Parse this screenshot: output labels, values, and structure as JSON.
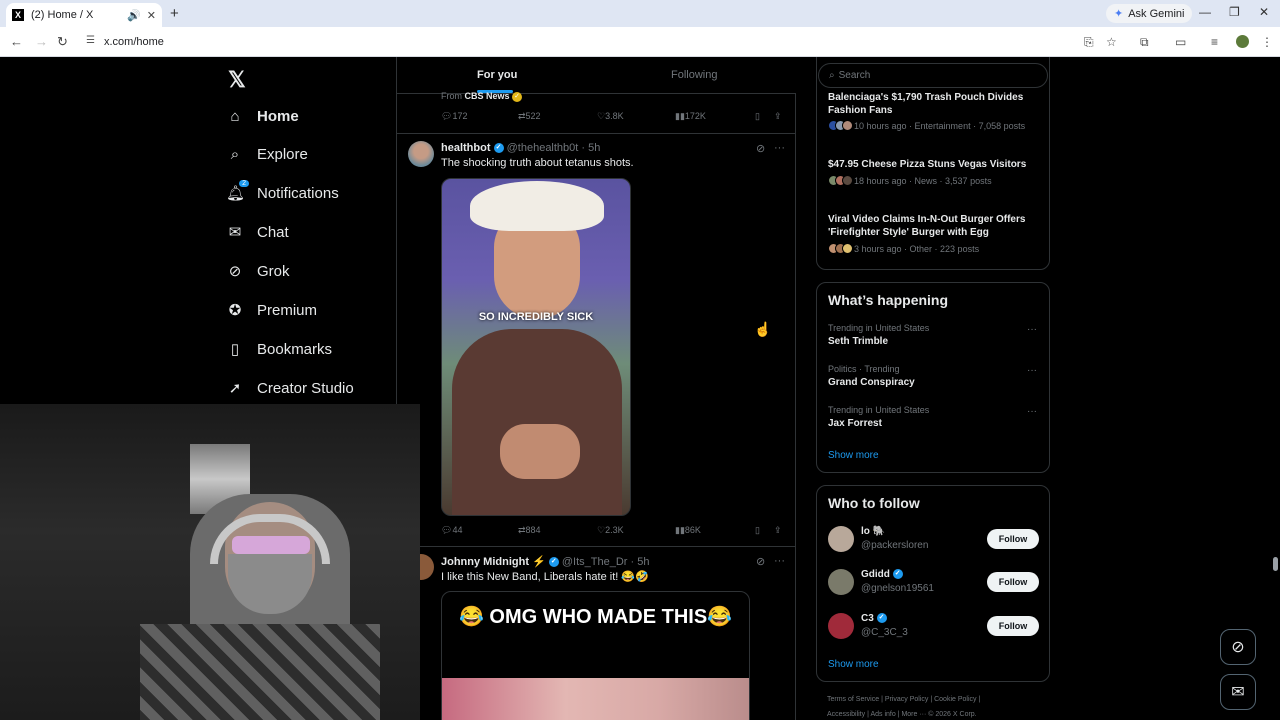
{
  "browser": {
    "tab_title": "(2) Home / X",
    "favicon": "X",
    "url": "x.com/home",
    "gemini_label": "Ask Gemini"
  },
  "nav": {
    "logo": "𝕏",
    "items": [
      {
        "label": "Home",
        "icon": "home-icon",
        "glyph": "⌂"
      },
      {
        "label": "Explore",
        "icon": "search-icon",
        "glyph": "⌕"
      },
      {
        "label": "Notifications",
        "icon": "bell-icon",
        "glyph": "♫",
        "badge": "2"
      },
      {
        "label": "Chat",
        "icon": "mail-icon",
        "glyph": "✉"
      },
      {
        "label": "Grok",
        "icon": "grok-icon",
        "glyph": "⊘"
      },
      {
        "label": "Premium",
        "icon": "verified-icon",
        "glyph": "✪"
      },
      {
        "label": "Bookmarks",
        "icon": "bookmark-icon",
        "glyph": "▯"
      },
      {
        "label": "Creator Studio",
        "icon": "rocket-icon",
        "glyph": "➚"
      }
    ]
  },
  "feed": {
    "tabs": {
      "for_you": "For you",
      "following": "Following"
    },
    "prev_post": {
      "source_prefix": "From",
      "source": "CBS News",
      "replies": "172",
      "reposts": "522",
      "likes": "3.8K",
      "views": "172K"
    },
    "post1": {
      "name": "healthbot",
      "handle": "@thehealthb0t · 5h",
      "text": "The shocking truth about tetanus shots.",
      "media_caption": "SO INCREDIBLY SICK",
      "replies": "44",
      "reposts": "884",
      "likes": "2.3K",
      "views": "86K"
    },
    "post2": {
      "name": "Johnny Midnight ⚡",
      "handle": "@Its_The_Dr · 5h",
      "text": "I like this New Band, Liberals hate it! 😂🤣",
      "media_caption": "😂 OMG WHO MADE THIS😂"
    }
  },
  "sidebar": {
    "search_placeholder": "Search",
    "news": [
      {
        "title": "Balenciaga's $1,790 Trash Pouch Divides Fashion Fans",
        "meta": "10 hours ago · Entertainment · 7,058 posts"
      },
      {
        "title": "$47.95 Cheese Pizza Stuns Vegas Visitors",
        "meta": "18 hours ago · News · 3,537 posts"
      },
      {
        "title": "Viral Video Claims In-N-Out Burger Offers 'Firefighter Style' Burger with Egg",
        "meta": "3 hours ago · Other · 223 posts"
      }
    ],
    "whats_happening": {
      "heading": "What’s happening",
      "trends": [
        {
          "context": "Trending in United States",
          "name": "Seth Trimble"
        },
        {
          "context": "Politics · Trending",
          "name": "Grand Conspiracy"
        },
        {
          "context": "Trending in United States",
          "name": "Jax Forrest"
        }
      ],
      "show_more": "Show more"
    },
    "who_to_follow": {
      "heading": "Who to follow",
      "accounts": [
        {
          "name": "lo 🐘",
          "handle": "@packersloren",
          "button": "Follow"
        },
        {
          "name": "Gdidd",
          "handle": "@gnelson19561",
          "button": "Follow"
        },
        {
          "name": "C3",
          "handle": "@C_3C_3",
          "button": "Follow"
        }
      ],
      "show_more": "Show more"
    },
    "footer_line1": "Terms of Service  |  Privacy Policy  |  Cookie Policy  |",
    "footer_line2": "Accessibility  |  Ads info  |  More ···  © 2026 X Corp."
  },
  "colors": {
    "accent": "#1d9bf0",
    "background": "#000000",
    "text": "#e7e9ea",
    "muted": "#71767b"
  }
}
